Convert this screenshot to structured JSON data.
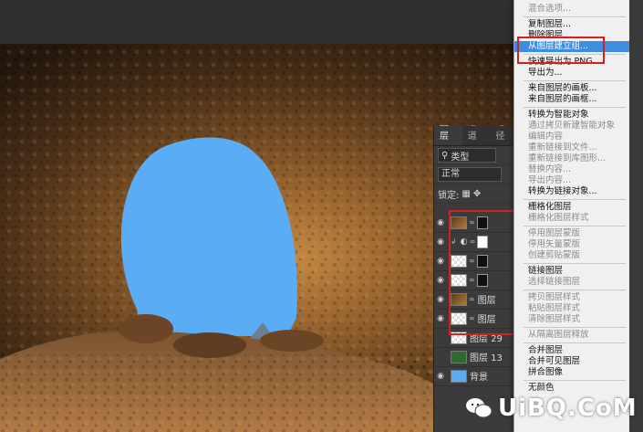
{
  "layers_panel": {
    "tabs": [
      "图层",
      "通道",
      "路径"
    ],
    "filter_label": "类型",
    "blend_mode": "正常",
    "lock_label": "锁定:",
    "layers": [
      {
        "name": "",
        "visible": true
      },
      {
        "name": "",
        "visible": true
      },
      {
        "name": "",
        "visible": true
      },
      {
        "name": "",
        "visible": true
      },
      {
        "name": "图层",
        "visible": true
      },
      {
        "name": "图层",
        "visible": true
      },
      {
        "name": "图层 29",
        "visible": false
      },
      {
        "name": "图层 13",
        "visible": false
      },
      {
        "name": "背景",
        "visible": true
      }
    ]
  },
  "context_menu": {
    "items": [
      {
        "label": "混合选项...",
        "disabled": true
      },
      {
        "sep": true
      },
      {
        "label": "复制图层...",
        "disabled": false
      },
      {
        "label": "删除图层",
        "disabled": false
      },
      {
        "label": "从图层建立组...",
        "disabled": false,
        "highlighted": true
      },
      {
        "sep": true
      },
      {
        "label": "快速导出为 PNG",
        "disabled": false
      },
      {
        "label": "导出为...",
        "disabled": false
      },
      {
        "sep": true
      },
      {
        "label": "来自图层的画板...",
        "disabled": false
      },
      {
        "label": "来自图层的画框...",
        "disabled": false
      },
      {
        "sep": true
      },
      {
        "label": "转换为智能对象",
        "disabled": false
      },
      {
        "label": "通过拷贝新建智能对象",
        "disabled": true
      },
      {
        "label": "编辑内容",
        "disabled": true
      },
      {
        "label": "重新链接到文件...",
        "disabled": true
      },
      {
        "label": "重新链接到库图形...",
        "disabled": true
      },
      {
        "label": "替换内容...",
        "disabled": true
      },
      {
        "label": "导出内容...",
        "disabled": true
      },
      {
        "label": "转换为链接对象...",
        "disabled": false
      },
      {
        "sep": true
      },
      {
        "label": "栅格化图层",
        "disabled": false
      },
      {
        "label": "栅格化图层样式",
        "disabled": true
      },
      {
        "sep": true
      },
      {
        "label": "停用图层蒙版",
        "disabled": true
      },
      {
        "label": "停用矢量蒙版",
        "disabled": true
      },
      {
        "label": "创建剪贴蒙版",
        "disabled": true
      },
      {
        "sep": true
      },
      {
        "label": "链接图层",
        "disabled": false
      },
      {
        "label": "选择链接图层",
        "disabled": true
      },
      {
        "sep": true
      },
      {
        "label": "拷贝图层样式",
        "disabled": true
      },
      {
        "label": "粘贴图层样式",
        "disabled": true
      },
      {
        "label": "清除图层样式",
        "disabled": true
      },
      {
        "sep": true
      },
      {
        "label": "从隔离图层释放",
        "disabled": true
      },
      {
        "sep": true
      },
      {
        "label": "合并图层",
        "disabled": false
      },
      {
        "label": "合并可见图层",
        "disabled": false
      },
      {
        "label": "拼合图像",
        "disabled": false
      },
      {
        "sep": true
      },
      {
        "label": "无颜色",
        "disabled": false
      }
    ]
  },
  "watermark": {
    "text": "UiBQ.CoM"
  },
  "colors": {
    "sky": "#5aacf5",
    "menu_highlight": "#3d8ee0",
    "annotation_red": "#d62020"
  }
}
